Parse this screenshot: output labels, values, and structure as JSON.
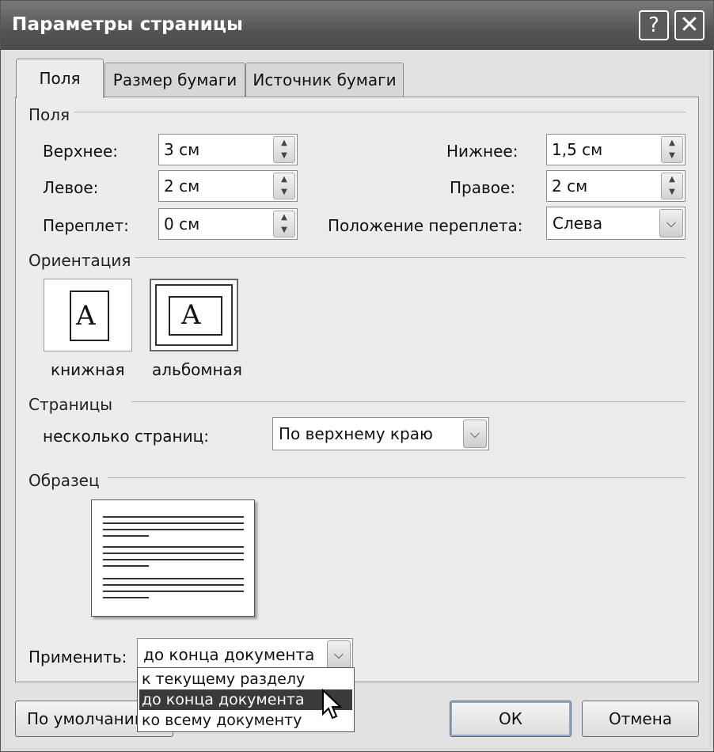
{
  "window": {
    "title": "Параметры страницы",
    "help_glyph": "?",
    "close_glyph": "✕"
  },
  "tabs": [
    {
      "label": "Поля",
      "selected": true
    },
    {
      "label": "Размер бумаги",
      "selected": false
    },
    {
      "label": "Источник бумаги",
      "selected": false
    }
  ],
  "margins": {
    "section": "Поля",
    "top": {
      "label": "Верхнее:",
      "value": "3 см"
    },
    "bottom": {
      "label": "Нижнее:",
      "value": "1,5 см"
    },
    "left": {
      "label": "Левое:",
      "value": "2 см"
    },
    "right": {
      "label": "Правое:",
      "value": "2 см"
    },
    "gutter": {
      "label": "Переплет:",
      "value": "0 см"
    },
    "gutter_position": {
      "label": "Положение переплета:",
      "value": "Слева"
    }
  },
  "orientation": {
    "section": "Ориентация",
    "portrait": {
      "label": "книжная",
      "glyph": "A"
    },
    "landscape": {
      "label": "альбомная",
      "glyph": "A",
      "selected": true
    }
  },
  "pages": {
    "section": "Страницы",
    "multiple_label": "несколько страниц:",
    "multiple_value": "По верхнему краю"
  },
  "preview": {
    "section": "Образец"
  },
  "apply": {
    "label": "Применить:",
    "value": "до конца документа",
    "options": [
      "к текущему разделу",
      "до конца документа",
      "ко всему документу"
    ],
    "highlighted": 1
  },
  "buttons": {
    "default": "По умолчанию...",
    "ok": "ОК",
    "cancel": "Отмена"
  },
  "icons": {
    "spin": "spin-arrows-icon",
    "dropdown": "chevron-down-icon",
    "cursor": "mouse-pointer-icon"
  }
}
